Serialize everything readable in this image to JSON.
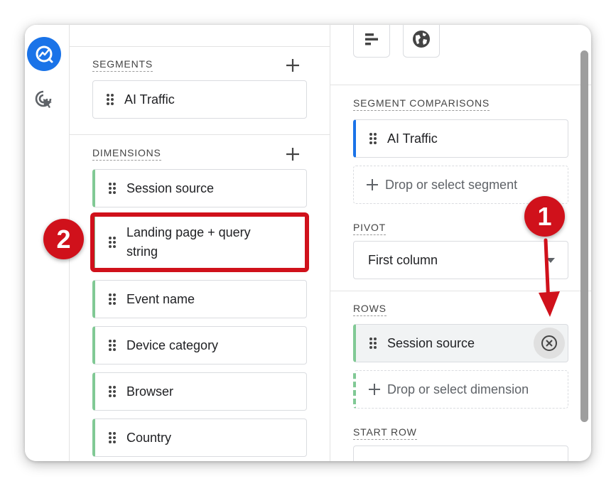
{
  "segments": {
    "label": "SEGMENTS",
    "items": [
      {
        "label": "AI Traffic"
      }
    ]
  },
  "dimensions": {
    "label": "DIMENSIONS",
    "items": [
      {
        "label": "Session source"
      },
      {
        "label": "Landing page + query string"
      },
      {
        "label": "Event name"
      },
      {
        "label": "Device category"
      },
      {
        "label": "Browser"
      },
      {
        "label": "Country"
      }
    ]
  },
  "segment_comparisons": {
    "label": "SEGMENT COMPARISONS",
    "items": [
      {
        "label": "AI Traffic"
      }
    ],
    "drop_placeholder": "Drop or select segment"
  },
  "pivot": {
    "label": "PIVOT",
    "value": "First column"
  },
  "rows": {
    "label": "ROWS",
    "items": [
      {
        "label": "Session source"
      }
    ],
    "drop_placeholder": "Drop or select dimension"
  },
  "start_row": {
    "label": "START ROW"
  },
  "callouts": {
    "one": "1",
    "two": "2"
  },
  "colors": {
    "accent": "#1a73e8",
    "callout": "#d0111b",
    "dimension": "#81c995"
  }
}
